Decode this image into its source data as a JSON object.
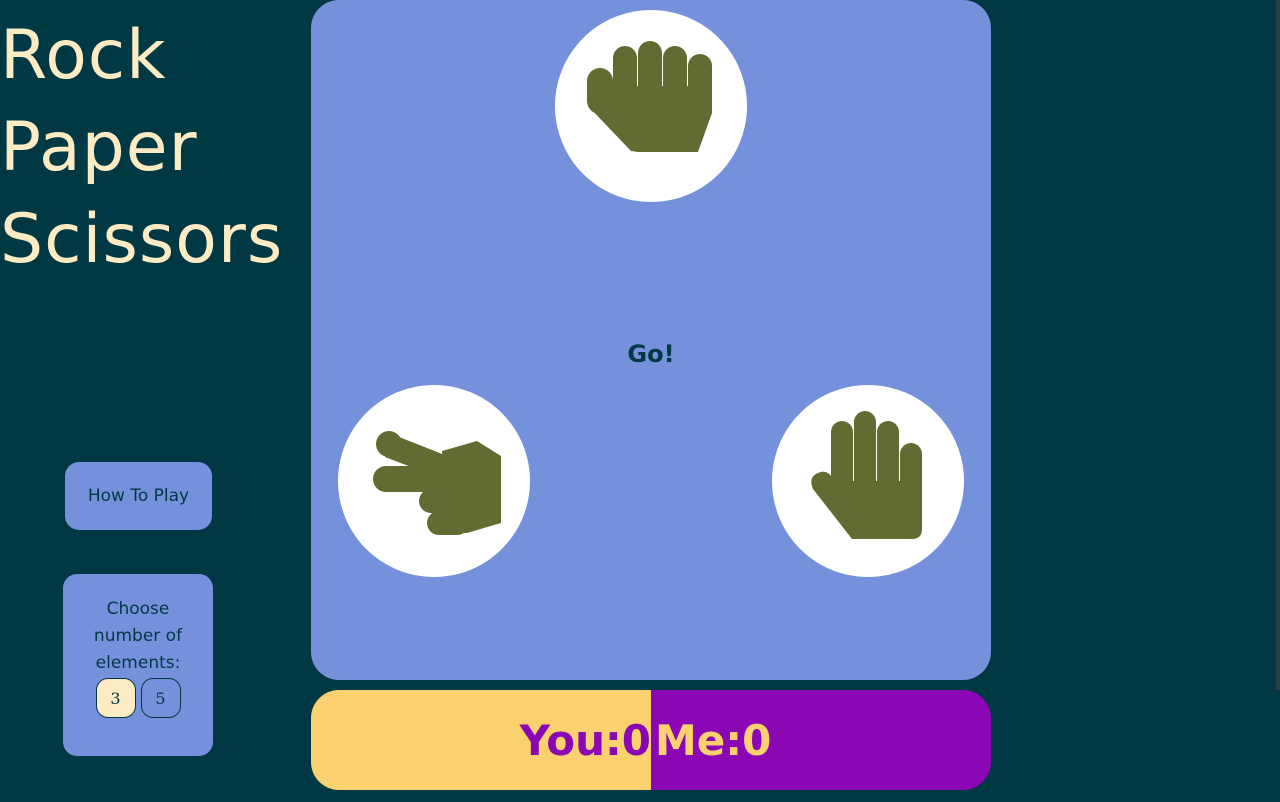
{
  "title": {
    "line1": "Rock",
    "line2": "Paper",
    "line3": "Scissors"
  },
  "sidebar": {
    "how_to_play_label": "How To Play",
    "elements_label": "Choose number of elements:",
    "element_options": [
      "3",
      "5"
    ],
    "selected_option": "3"
  },
  "board": {
    "status_text": "Go!",
    "choices": [
      {
        "name": "Rock",
        "icon": "fist-icon"
      },
      {
        "name": "Scissors",
        "icon": "two-fingers-icon"
      },
      {
        "name": "Paper",
        "icon": "open-hand-icon"
      }
    ]
  },
  "score": {
    "you_label": "You:",
    "you_value": "0",
    "me_label": "Me:",
    "me_value": "0"
  },
  "colors": {
    "background": "#003844",
    "title": "#fdecc3",
    "panel": "#7591dc",
    "icon": "#606c31",
    "you": "#fad16e",
    "me": "#8a07b3"
  }
}
